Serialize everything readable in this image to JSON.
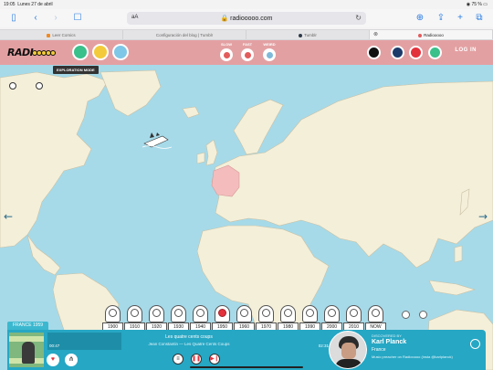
{
  "status_bar": {
    "time": "19:05",
    "date": "Lunes 27 de abril",
    "battery": "75 %"
  },
  "browser": {
    "url_prefix": "aA",
    "url": "radiooooo.com",
    "tabs": [
      {
        "label": "Leer Comics",
        "color": "#f08a24"
      },
      {
        "label": "Configuración del blog | Tumblr",
        "color": "#d4d4d4"
      },
      {
        "label": "Tumblr",
        "color": "#2f3a4a"
      },
      {
        "label": "Radiooooo",
        "color": "#e35b5b"
      }
    ]
  },
  "header": {
    "logo": "RADIOOOOO",
    "modes": [
      {
        "label": "SLOW"
      },
      {
        "label": "FAST"
      },
      {
        "label": "WEIRD"
      }
    ],
    "login": "LOG IN",
    "exploration_mode": "EXPLORATION MODE",
    "colors": {
      "header_bg": "#e3a0a2",
      "sea": "#a6dae9",
      "land": "#f4efd9",
      "selected_country": "#f4bcbc"
    }
  },
  "timeline": {
    "decades": [
      "1900",
      "1910",
      "1920",
      "1930",
      "1940",
      "1950",
      "1960",
      "1970",
      "1980",
      "1990",
      "2000",
      "2010",
      "NOW"
    ],
    "selected": "1950"
  },
  "player": {
    "country_decade": "FRANCE  1959",
    "elapsed": "00:47",
    "duration": "02:31",
    "progress_fraction": 0.26,
    "song_title": "Les quatre cents coups",
    "song_credit": "Jean Constantin — Les Quatre Cents Coups",
    "discovered_by_label": "DISCOVERED BY",
    "curator_name": "Karl Planck",
    "curator_country": "France",
    "curator_desc": "Music preacher on Radiooooo (insta @karlplanck)"
  }
}
